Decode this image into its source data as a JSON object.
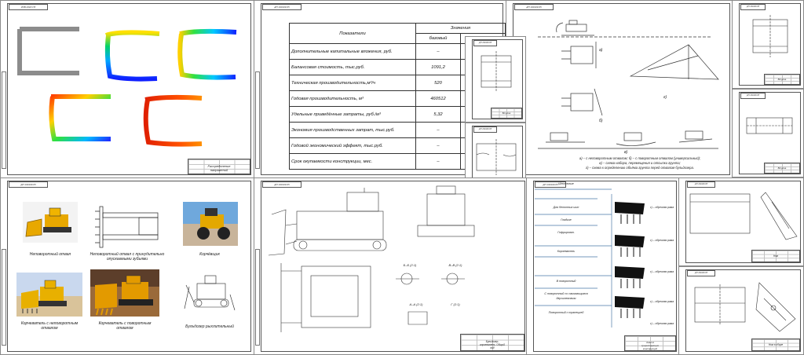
{
  "sheet1": {
    "corner_tag": "ИЗВ 2018-ПЗ",
    "titleblock": "Распределение напряжений"
  },
  "sheet2": {
    "corner_tag": "ДП 190109.65",
    "table": {
      "col_name": "Показатели",
      "col_values": "Значения",
      "col_base": "базовый",
      "col_project": "проектный",
      "rows": [
        {
          "name": "Дополнительные капитальные вложения, руб.",
          "base": "–",
          "project": "55992"
        },
        {
          "name": "Балансовая стоимость, тыс.руб.",
          "base": "1091,2",
          "project": "1027,2"
        },
        {
          "name": "Техническая производительность,м³/ч",
          "base": "520",
          "project": "576"
        },
        {
          "name": "Годовая производительность, м³",
          "base": "460512",
          "project": "510096"
        },
        {
          "name": "Удельные приведённые затраты, руб./м³",
          "base": "5,32",
          "project": "4,90"
        },
        {
          "name": "Экономия производственных затрат, тыс.руб.",
          "base": "–",
          "project": "204,0"
        },
        {
          "name": "Годовой экономический эффект, тыс.руб.",
          "base": "–",
          "project": "511,2"
        },
        {
          "name": "Срок окупаемости конструкции, мес.",
          "base": "–",
          "project": "4"
        }
      ]
    }
  },
  "sheet3": {
    "corner_tag": "ДП 190109.65",
    "caption_lines": [
      "а) – с неповоротным отвалом; б) – с поворотным отвалом (универсальный);",
      "в) – схема набора, перемещения и отсыпки грунта;",
      "г) – схема к определению объёма грунта перед отвалом бульдозера."
    ],
    "label_a": "а)",
    "label_b": "б)",
    "label_c": "в)",
    "label_d": "г)"
  },
  "sheet4": {
    "corner_tag": "ДП 190109.65",
    "titleblock": "Втулка"
  },
  "sheet5": {
    "corner_tag": "ДП 190109.65",
    "titleblock": "Ось"
  },
  "sheet6": {
    "corner_tag": "ДП 190109.65",
    "titleblock": "Втулка"
  },
  "sheet7": {
    "corner_tag": "ДП 190109.65",
    "titleblock": "Втулка"
  },
  "sheet8": {
    "corner_tag": "ДП 190109.65",
    "captions": {
      "c1": "Неповоротный отвал",
      "c2": "Неповоротный отвал с принудительно опускаемыми зубьями",
      "c3": "Корчёвщик",
      "c4": "Корчеватель с неповоротным отвалом",
      "c5": "Корчеватель с поворотным отвалом",
      "c6": "Бульдозер рыхлительный"
    }
  },
  "sheet9": {
    "corner_tag": "ДП 190109.65",
    "section_labels": [
      "Б–Б (2:1)",
      "В–В (2:1)",
      "А–А (2:1)",
      "Г (2:1)"
    ],
    "titleblock": "Бульдозер-корчеватель. Общий вид"
  },
  "sheet10": {
    "corner_tag": "ДП 190109.65",
    "labels": [
      "Шпоночные",
      "Для бетонных шин",
      "Гладкие",
      "Гофрирован.",
      "Корчеватель",
      "В поворотный",
      "С поворотный со сжимающимся двухшнековым",
      "Поворотный с трапецией"
    ],
    "right_labels": [
      "c) – обрезная рама",
      "c) – обрезная рама",
      "c) – обрезная рама",
      "c) – обрезная рама",
      "c) – обрезная рама"
    ],
    "titleblock": "Анализ существующих конструкций"
  },
  "sheet11": {
    "corner_tag": "ДП 190109.65",
    "titleblock": "Нож"
  },
  "sheet12": {
    "corner_tag": "ДП 190109.65",
    "titleblock": "Нож в сборе"
  }
}
